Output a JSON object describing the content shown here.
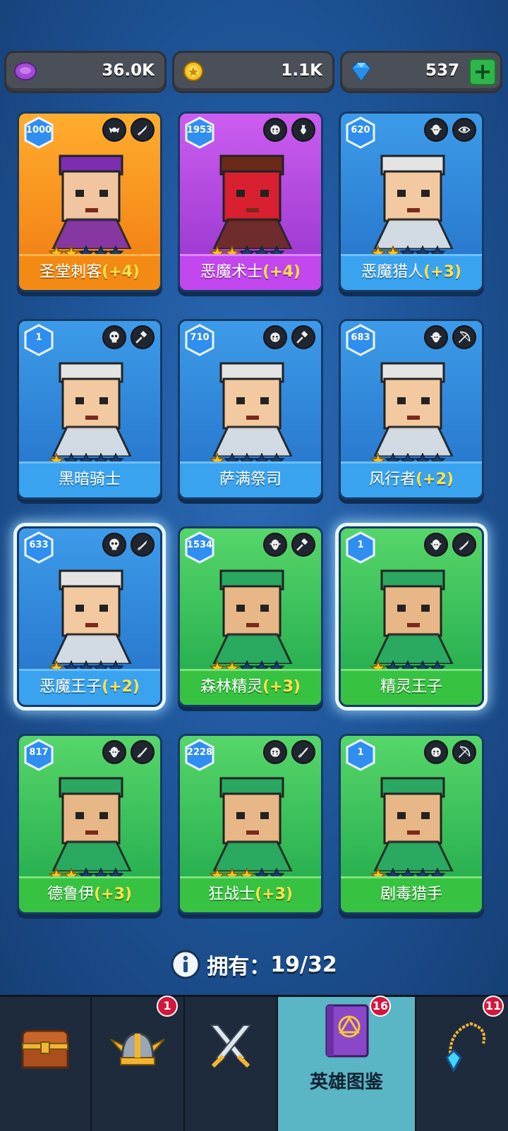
{
  "currencies": {
    "orbs": "36.0K",
    "coins": "1.1K",
    "gems": "537",
    "gems_add_label": "+"
  },
  "heroes": [
    {
      "name": "圣堂刺客",
      "bonus": "(+4)",
      "level": "1000",
      "stars": 2,
      "color": "orange",
      "classes": [
        "winged-emblem-icon",
        "dagger-icon"
      ]
    },
    {
      "name": "恶魔术士",
      "bonus": "(+4)",
      "level": "1953",
      "stars": 2,
      "color": "purple",
      "classes": [
        "orc-face-icon",
        "magic-potion-icon"
      ]
    },
    {
      "name": "恶魔猎人",
      "bonus": "(+3)",
      "level": "620",
      "stars": 2,
      "color": "blue",
      "classes": [
        "elf-face-icon",
        "eye-icon"
      ]
    },
    {
      "name": "黑暗骑士",
      "bonus": "",
      "level": "1",
      "stars": 1,
      "color": "blue",
      "classes": [
        "skull-icon",
        "hammer-icon"
      ]
    },
    {
      "name": "萨满祭司",
      "bonus": "",
      "level": "710",
      "stars": 1,
      "color": "blue",
      "classes": [
        "orc-face-icon",
        "hammer-icon"
      ]
    },
    {
      "name": "风行者",
      "bonus": "(+2)",
      "level": "683",
      "stars": 1,
      "color": "blue",
      "classes": [
        "elf-face-icon",
        "bow-icon"
      ]
    },
    {
      "name": "恶魔王子",
      "bonus": "(+2)",
      "level": "633",
      "stars": 1,
      "color": "blue",
      "selected": true,
      "classes": [
        "skull-icon",
        "dagger-icon"
      ]
    },
    {
      "name": "森林精灵",
      "bonus": "(+3)",
      "level": "1534",
      "stars": 2,
      "color": "green",
      "classes": [
        "elf-face-icon",
        "hammer-icon"
      ]
    },
    {
      "name": "精灵王子",
      "bonus": "",
      "level": "1",
      "stars": 1,
      "color": "green",
      "selected": true,
      "classes": [
        "elf-face-icon",
        "dagger-icon"
      ]
    },
    {
      "name": "德鲁伊",
      "bonus": "(+3)",
      "level": "817",
      "stars": 2,
      "color": "green",
      "classes": [
        "elf-face-icon",
        "sword-icon"
      ]
    },
    {
      "name": "狂战士",
      "bonus": "(+3)",
      "level": "2228",
      "stars": 3,
      "color": "green",
      "classes": [
        "orc-face-icon",
        "sword-icon"
      ]
    },
    {
      "name": "剧毒猎手",
      "bonus": "",
      "level": "1",
      "stars": 1,
      "color": "green",
      "classes": [
        "orc-face-icon",
        "bow-icon"
      ]
    }
  ],
  "owned": {
    "label": "拥有：",
    "count": "19/32"
  },
  "nav": {
    "items": [
      {
        "name": "chest",
        "icon": "treasure-chest-icon",
        "label": "",
        "badge": ""
      },
      {
        "name": "heroes",
        "icon": "winged-helmet-icon",
        "label": "",
        "badge": "1"
      },
      {
        "name": "battle",
        "icon": "crossed-swords-icon",
        "label": "",
        "badge": ""
      },
      {
        "name": "encyclopedia",
        "icon": "spellbook-icon",
        "label": "英雄图鉴",
        "badge": "16",
        "active": true
      },
      {
        "name": "amulet",
        "icon": "amulet-icon",
        "label": "",
        "badge": "11"
      }
    ]
  },
  "colors": {
    "background": "#1f579c",
    "card_blue": "#3aa3f0",
    "card_green": "#38c241",
    "card_orange": "#f28a14",
    "card_purple": "#c247ef",
    "bonus_text": "#ffe14a",
    "nav_active": "#5ab5c4"
  }
}
